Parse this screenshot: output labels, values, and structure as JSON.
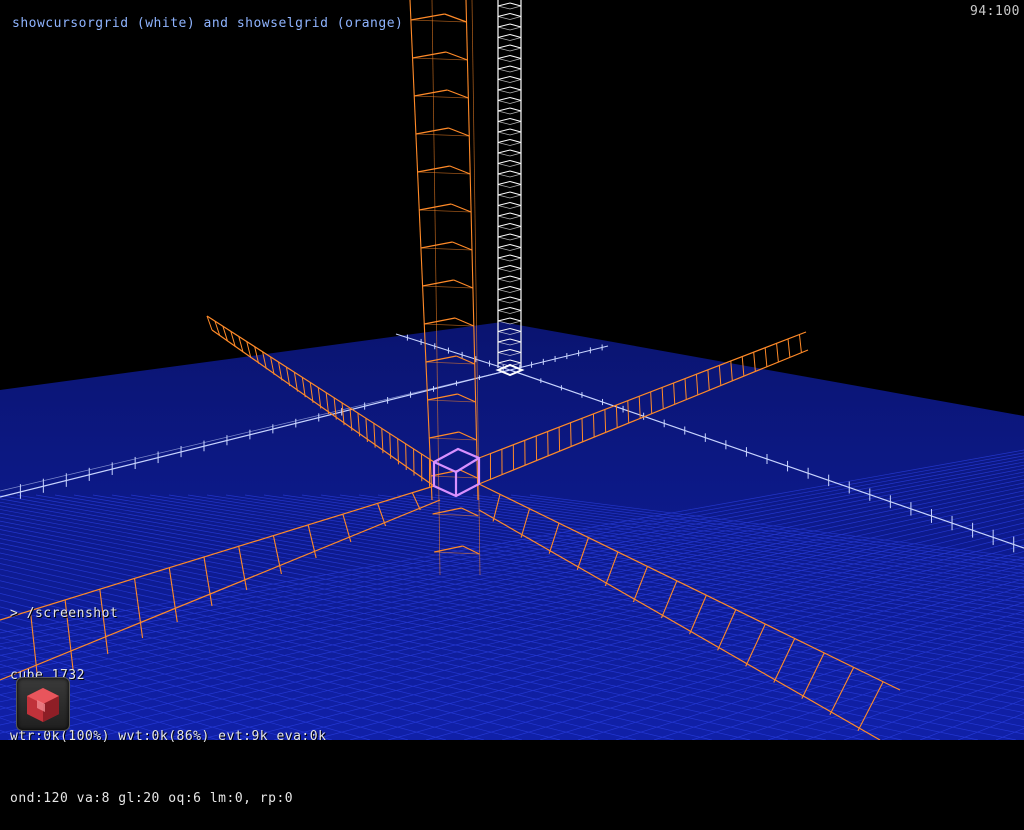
{
  "hud": {
    "help_text": "showcursorgrid (white) and showselgrid (orange)",
    "fps_counter": "94:100"
  },
  "console": {
    "prompt_line": "> /screenshot",
    "stats": [
      "cube 1732",
      "wtr:0k(100%) wvt:0k(86%) evt:9k eva:0k",
      "ond:120 va:8 gl:20 oq:6 lm:0, rp:0"
    ]
  },
  "icons": {
    "edit_mode": "edit-cube-icon"
  },
  "colors": {
    "background": "#000000",
    "floor": "#0c1a88",
    "floor_grid": "#2a3fe0",
    "cursor_grid": "#ffffff",
    "selection_grid": "#ff8a28",
    "selected_cube": "#d890ff",
    "help_text": "#8fb4ff"
  }
}
